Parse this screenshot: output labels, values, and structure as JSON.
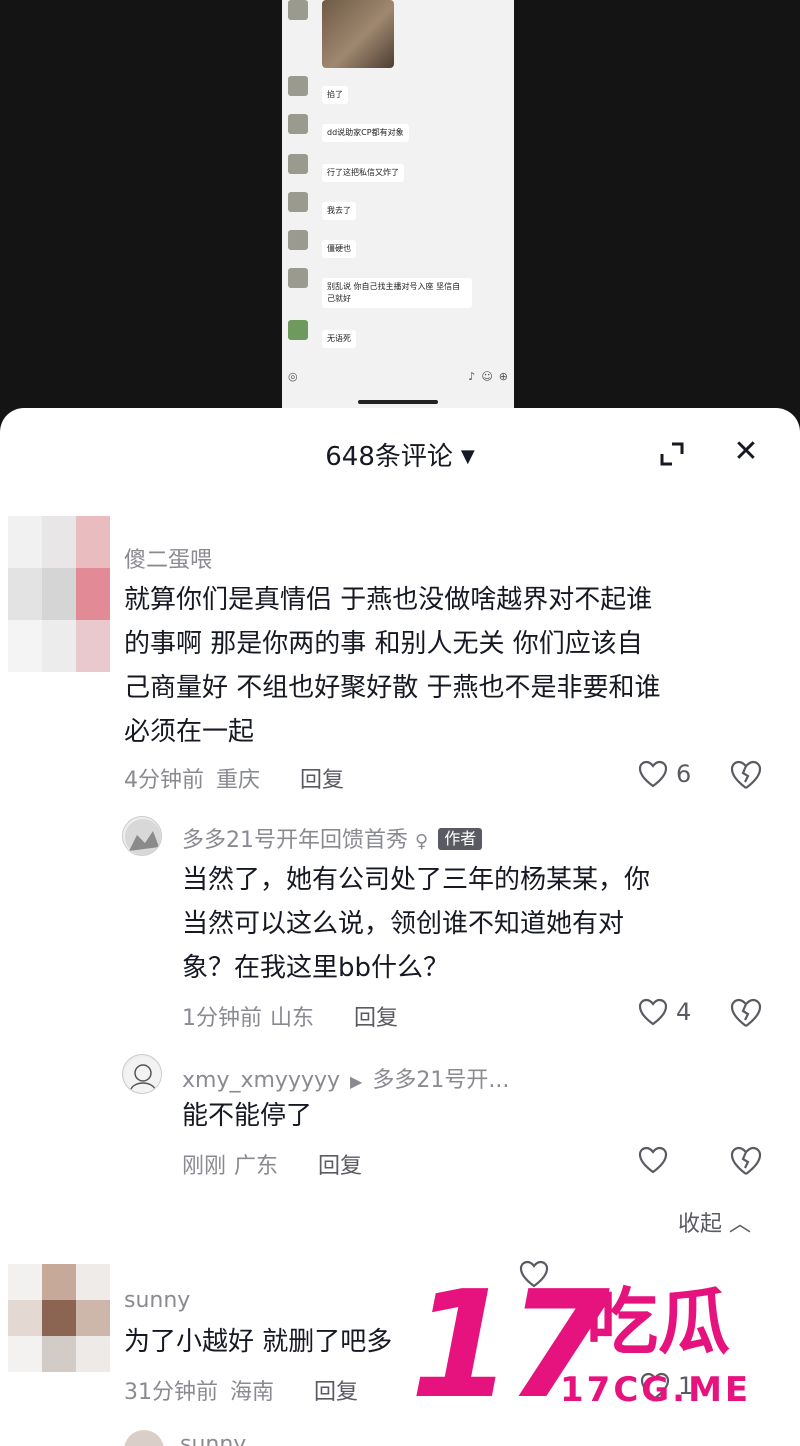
{
  "phone_chat": {
    "messages": [
      {
        "name": "",
        "text": "掐了"
      },
      {
        "name": "",
        "text": "dd说助家CP都有对象"
      },
      {
        "name": "",
        "text": "行了这把私信又炸了"
      },
      {
        "name": "",
        "text": "我去了"
      },
      {
        "name": "",
        "text": "僵硬也"
      },
      {
        "name": "",
        "text": "别乱说 你自己找主播对号入座 坚信自己就好"
      },
      {
        "name": "",
        "text": "无语死"
      }
    ]
  },
  "panel": {
    "title": "648条评论",
    "caret": "▼",
    "close": "✕"
  },
  "comments": [
    {
      "user": "傻二蛋喂",
      "text_lines": [
        "就算你们是真情侣  于燕也没做啥越界对不起谁",
        "的事啊 那是你两的事 和别人无关 你们应该自",
        "己商量好 不组也好聚好散 于燕也不是非要和谁",
        "必须在一起"
      ],
      "time": "4分钟前",
      "location": "重庆",
      "reply_label": "回复",
      "likes": "6"
    },
    {
      "user": "多多21号开年回馈首秀",
      "author_tag": "作者",
      "text_lines": [
        "当然了，她有公司处了三年的杨某某，你",
        "当然可以这么说，领创谁不知道她有对",
        "象？在我这里bb什么？"
      ],
      "time": "1分钟前",
      "location": "山东",
      "reply_label": "回复",
      "likes": "4"
    },
    {
      "user": "xmy_xmyyyyy",
      "reply_to": "多多21号开...",
      "text_lines": [
        "能不能停了"
      ],
      "time": "刚刚",
      "location": "广东",
      "reply_label": "回复",
      "likes": ""
    },
    {
      "user": "sunny",
      "text_lines": [
        "为了小越好 就删了吧多"
      ],
      "time": "31分钟前",
      "location": "海南",
      "reply_label": "回复",
      "likes": "1"
    },
    {
      "user": "sunny"
    }
  ],
  "collapse_label": "收起 ︿",
  "watermark": {
    "number": "17",
    "chinese": "吃瓜",
    "domain": "17CG.ME",
    "color": "#e6137e"
  }
}
